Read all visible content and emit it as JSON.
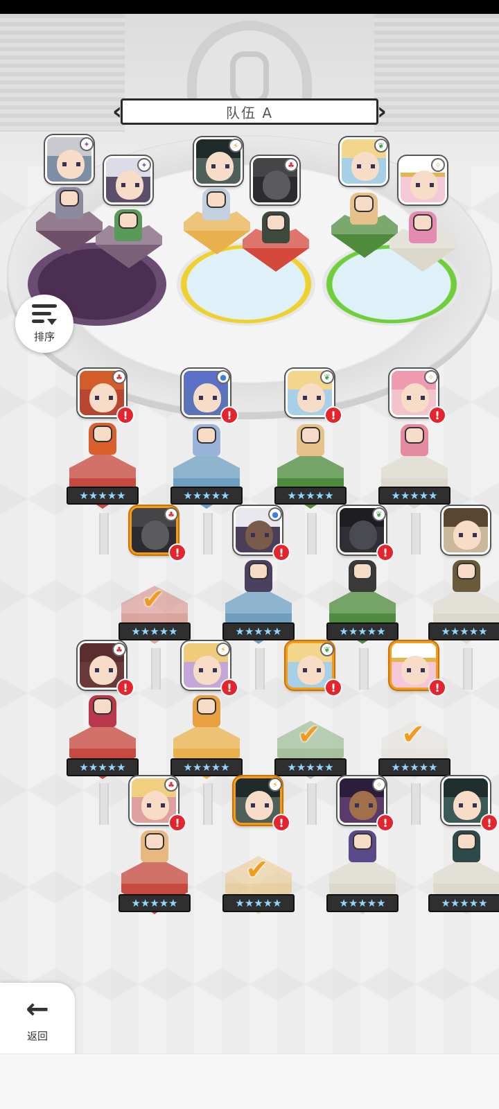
{
  "team": {
    "title": "队伍 A",
    "prev_icon": "chevron-left-icon",
    "next_icon": "chevron-right-icon"
  },
  "sort": {
    "label": "排序",
    "icon": "sort-icon"
  },
  "back": {
    "label": "返回",
    "icon": "arrow-left-icon"
  },
  "elements": {
    "dark": {
      "glyph": "✦",
      "color": "#8a5aa8"
    },
    "light": {
      "glyph": "⚡",
      "color": "#e2a400"
    },
    "fire": {
      "glyph": "♣",
      "color": "#d8313a"
    },
    "nature": {
      "glyph": "❦",
      "color": "#3aa54a"
    },
    "holy": {
      "glyph": "✧",
      "color": "#c8b860"
    },
    "water": {
      "glyph": "●",
      "color": "#3b7fe0"
    }
  },
  "stars_row": "★★★★★",
  "alert_glyph": "!",
  "check_glyph": "✔"
}
